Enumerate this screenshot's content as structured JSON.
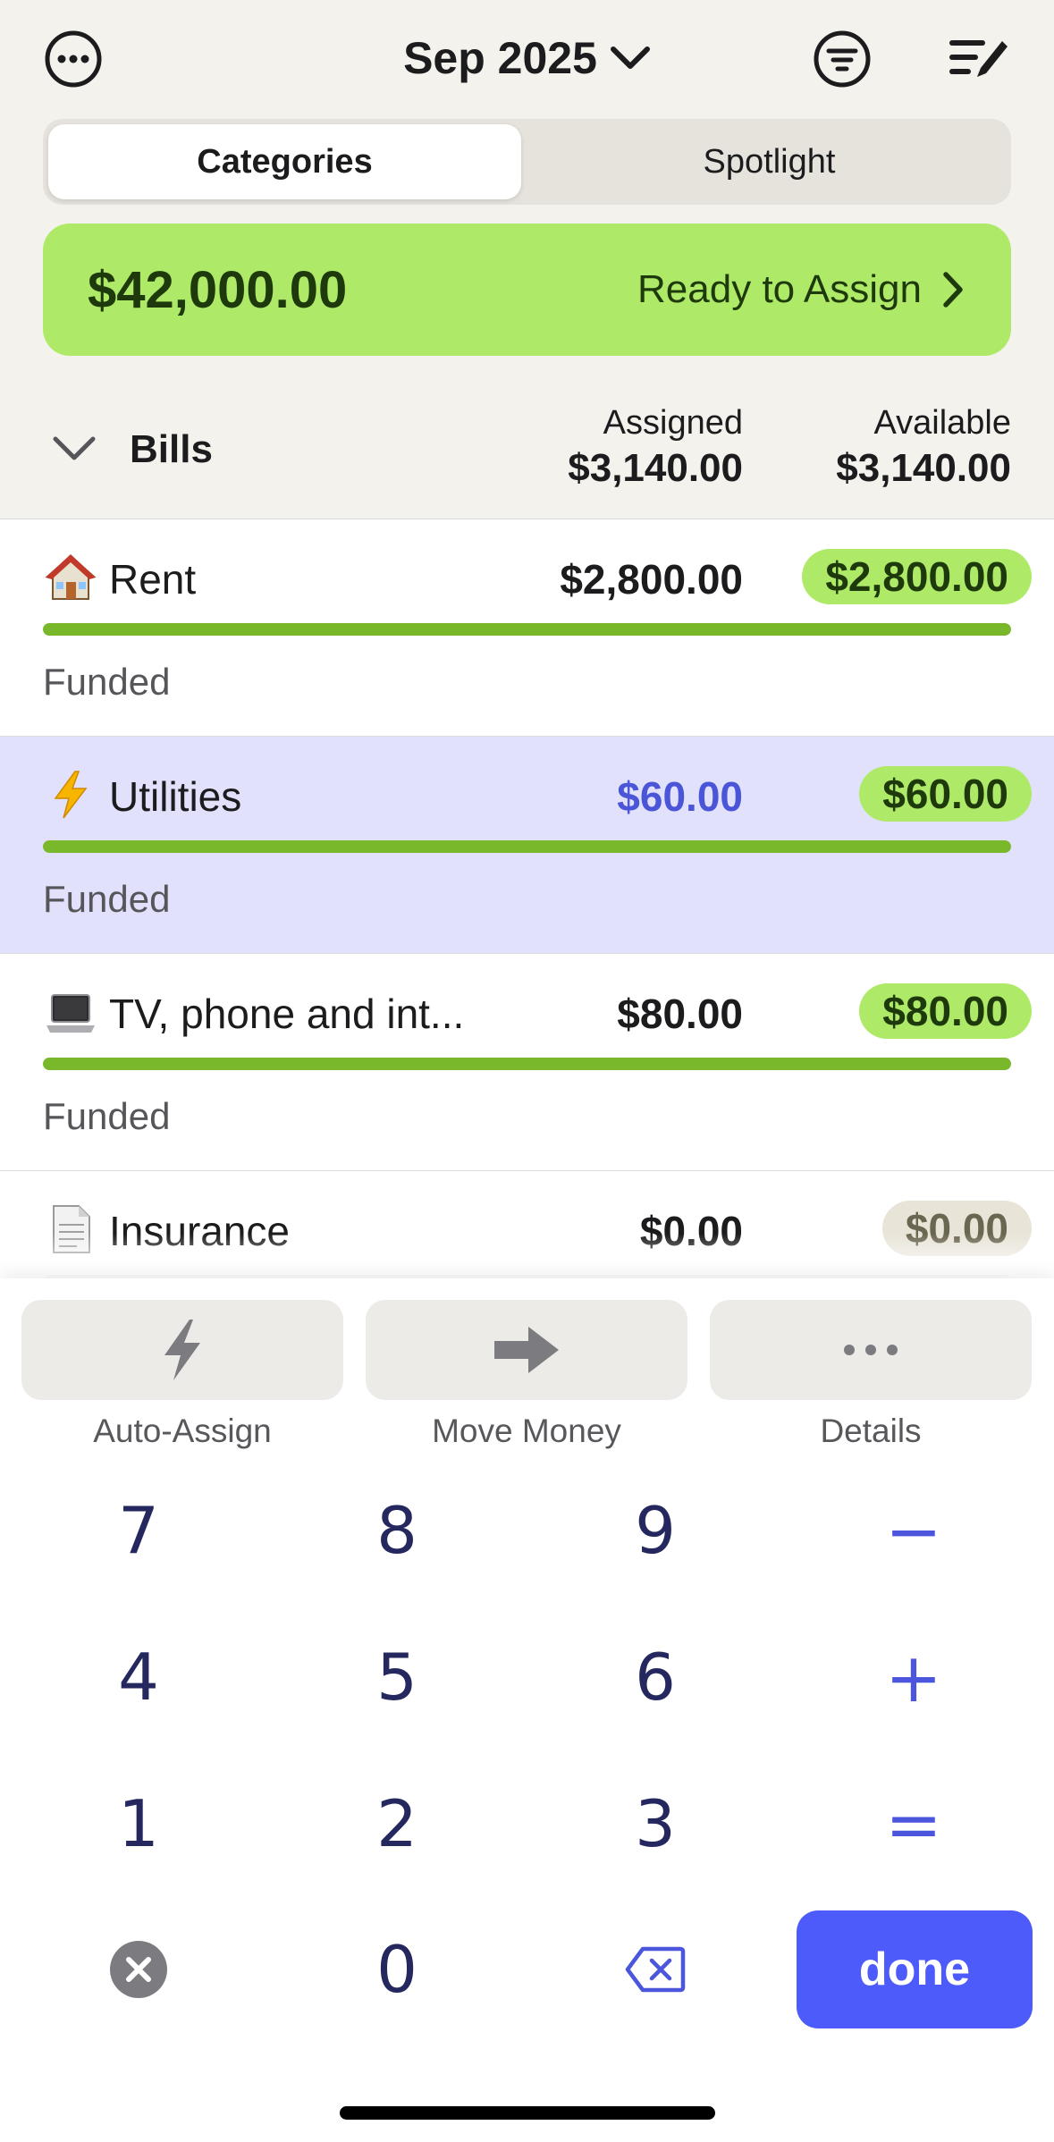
{
  "header": {
    "month": "Sep 2025",
    "tabs": [
      "Categories",
      "Spotlight"
    ],
    "active_tab": "Categories"
  },
  "ready_to_assign": {
    "amount": "$42,000.00",
    "label": "Ready to Assign"
  },
  "group": {
    "name": "Bills",
    "assigned_label": "Assigned",
    "assigned_total": "$3,140.00",
    "available_label": "Available",
    "available_total": "$3,140.00"
  },
  "categories": [
    {
      "icon": "house-icon",
      "name": "Rent",
      "assigned": "$2,800.00",
      "available": "$2,800.00",
      "funded_fraction": 1.0,
      "status": "Funded",
      "selected": false
    },
    {
      "icon": "lightning-icon",
      "name": "Utilities",
      "assigned": "$60.00",
      "available": "$60.00",
      "funded_fraction": 1.0,
      "status": "Funded",
      "selected": true
    },
    {
      "icon": "laptop-icon",
      "name": "TV, phone and int...",
      "assigned": "$80.00",
      "available": "$80.00",
      "funded_fraction": 1.0,
      "status": "Funded",
      "selected": false
    },
    {
      "icon": "document-icon",
      "name": "Insurance",
      "assigned": "$0.00",
      "available": "$0.00",
      "funded_fraction": 0.0,
      "status": "",
      "selected": false
    }
  ],
  "actions": [
    "Auto-Assign",
    "Move Money",
    "Details"
  ],
  "keypad": {
    "digits": [
      "7",
      "8",
      "9",
      "4",
      "5",
      "6",
      "1",
      "2",
      "3",
      "0"
    ],
    "ops": [
      "−",
      "+",
      "="
    ],
    "done_label": "done"
  },
  "colors": {
    "accent": "#4d5bfb",
    "funded_green": "#aeea68",
    "bar_green": "#78b82a",
    "selected_row": "#e1e1fb",
    "header_bg": "#f4f2ec"
  }
}
